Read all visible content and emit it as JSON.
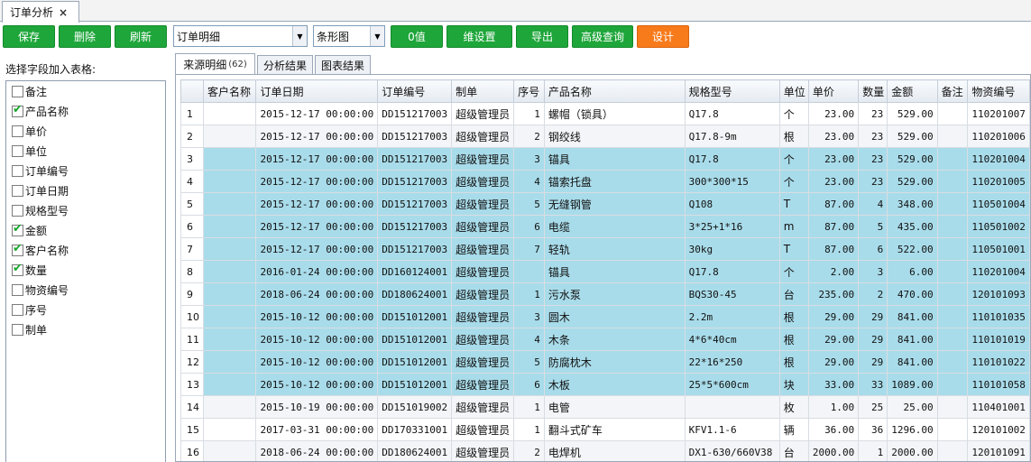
{
  "tab": {
    "title": "订单分析",
    "close": "×"
  },
  "toolbar": {
    "save": "保存",
    "delete": "删除",
    "refresh": "刷新",
    "report_select": "订单明细",
    "chart_select": "条形图",
    "zero_value": "0值",
    "dimension": "维设置",
    "export": "导出",
    "advanced_query": "高级查询",
    "design": "设计"
  },
  "fields": {
    "title": "选择字段加入表格:",
    "items": [
      {
        "label": "备注",
        "checked": false
      },
      {
        "label": "产品名称",
        "checked": true
      },
      {
        "label": "单价",
        "checked": false
      },
      {
        "label": "单位",
        "checked": false
      },
      {
        "label": "订单编号",
        "checked": false
      },
      {
        "label": "订单日期",
        "checked": false
      },
      {
        "label": "规格型号",
        "checked": false
      },
      {
        "label": "金额",
        "checked": true
      },
      {
        "label": "客户名称",
        "checked": true
      },
      {
        "label": "数量",
        "checked": true
      },
      {
        "label": "物资编号",
        "checked": false
      },
      {
        "label": "序号",
        "checked": false
      },
      {
        "label": "制单",
        "checked": false
      }
    ]
  },
  "result_tabs": {
    "source": "来源明细",
    "count": "(62)",
    "analysis": "分析结果",
    "chart": "图表结果"
  },
  "grid": {
    "columns": [
      "",
      "客户名称",
      "订单日期",
      "订单编号",
      "制单",
      "序号",
      "产品名称",
      "规格型号",
      "单位",
      "单价",
      "数量",
      "金额",
      "备注",
      "物资编号"
    ],
    "rows": [
      {
        "n": "1",
        "cust": "",
        "date": "2015-12-17 00:00:00",
        "order": "DD151217003",
        "maker": "超级管理员",
        "seq": "1",
        "product": "螺帽（锁具）",
        "spec": "Q17.8",
        "unit": "个",
        "price": "23.00",
        "qty": "23",
        "amount": "529.00",
        "note": "",
        "code": "110201007",
        "sel": false
      },
      {
        "n": "2",
        "cust": "",
        "date": "2015-12-17 00:00:00",
        "order": "DD151217003",
        "maker": "超级管理员",
        "seq": "2",
        "product": "钢绞线",
        "spec": "Q17.8-9m",
        "unit": "根",
        "price": "23.00",
        "qty": "23",
        "amount": "529.00",
        "note": "",
        "code": "110201006",
        "sel": false
      },
      {
        "n": "3",
        "cust": "",
        "date": "2015-12-17 00:00:00",
        "order": "DD151217003",
        "maker": "超级管理员",
        "seq": "3",
        "product": "锚具",
        "spec": "Q17.8",
        "unit": "个",
        "price": "23.00",
        "qty": "23",
        "amount": "529.00",
        "note": "",
        "code": "110201004",
        "sel": true
      },
      {
        "n": "4",
        "cust": "",
        "date": "2015-12-17 00:00:00",
        "order": "DD151217003",
        "maker": "超级管理员",
        "seq": "4",
        "product": "锚索托盘",
        "spec": "300*300*15",
        "unit": "个",
        "price": "23.00",
        "qty": "23",
        "amount": "529.00",
        "note": "",
        "code": "110201005",
        "sel": true
      },
      {
        "n": "5",
        "cust": "",
        "date": "2015-12-17 00:00:00",
        "order": "DD151217003",
        "maker": "超级管理员",
        "seq": "5",
        "product": "无缝钢管",
        "spec": "Q108",
        "unit": "T",
        "price": "87.00",
        "qty": "4",
        "amount": "348.00",
        "note": "",
        "code": "110501004",
        "sel": true
      },
      {
        "n": "6",
        "cust": "",
        "date": "2015-12-17 00:00:00",
        "order": "DD151217003",
        "maker": "超级管理员",
        "seq": "6",
        "product": "电缆",
        "spec": "3*25+1*16",
        "unit": "m",
        "price": "87.00",
        "qty": "5",
        "amount": "435.00",
        "note": "",
        "code": "110501002",
        "sel": true
      },
      {
        "n": "7",
        "cust": "",
        "date": "2015-12-17 00:00:00",
        "order": "DD151217003",
        "maker": "超级管理员",
        "seq": "7",
        "product": "轻轨",
        "spec": "30kg",
        "unit": "T",
        "price": "87.00",
        "qty": "6",
        "amount": "522.00",
        "note": "",
        "code": "110501001",
        "sel": true
      },
      {
        "n": "8",
        "cust": "",
        "date": "2016-01-24 00:00:00",
        "order": "DD160124001",
        "maker": "超级管理员",
        "seq": "",
        "product": "锚具",
        "spec": "Q17.8",
        "unit": "个",
        "price": "2.00",
        "qty": "3",
        "amount": "6.00",
        "note": "",
        "code": "110201004",
        "sel": true
      },
      {
        "n": "9",
        "cust": "",
        "date": "2018-06-24 00:00:00",
        "order": "DD180624001",
        "maker": "超级管理员",
        "seq": "1",
        "product": "污水泵",
        "spec": "BQS30-45",
        "unit": "台",
        "price": "235.00",
        "qty": "2",
        "amount": "470.00",
        "note": "",
        "code": "120101093",
        "sel": true
      },
      {
        "n": "10",
        "cust": "",
        "date": "2015-10-12 00:00:00",
        "order": "DD151012001",
        "maker": "超级管理员",
        "seq": "3",
        "product": "圆木",
        "spec": "2.2m",
        "unit": "根",
        "price": "29.00",
        "qty": "29",
        "amount": "841.00",
        "note": "",
        "code": "110101035",
        "sel": true
      },
      {
        "n": "11",
        "cust": "",
        "date": "2015-10-12 00:00:00",
        "order": "DD151012001",
        "maker": "超级管理员",
        "seq": "4",
        "product": "木条",
        "spec": "4*6*40cm",
        "unit": "根",
        "price": "29.00",
        "qty": "29",
        "amount": "841.00",
        "note": "",
        "code": "110101019",
        "sel": true
      },
      {
        "n": "12",
        "cust": "",
        "date": "2015-10-12 00:00:00",
        "order": "DD151012001",
        "maker": "超级管理员",
        "seq": "5",
        "product": "防腐枕木",
        "spec": "22*16*250",
        "unit": "根",
        "price": "29.00",
        "qty": "29",
        "amount": "841.00",
        "note": "",
        "code": "110101022",
        "sel": true
      },
      {
        "n": "13",
        "cust": "",
        "date": "2015-10-12 00:00:00",
        "order": "DD151012001",
        "maker": "超级管理员",
        "seq": "6",
        "product": "木板",
        "spec": "25*5*600cm",
        "unit": "块",
        "price": "33.00",
        "qty": "33",
        "amount": "1089.00",
        "note": "",
        "code": "110101058",
        "sel": true
      },
      {
        "n": "14",
        "cust": "",
        "date": "2015-10-19 00:00:00",
        "order": "DD151019002",
        "maker": "超级管理员",
        "seq": "1",
        "product": "电管",
        "spec": "",
        "unit": "枚",
        "price": "1.00",
        "qty": "25",
        "amount": "25.00",
        "note": "",
        "code": "110401001",
        "sel": false
      },
      {
        "n": "15",
        "cust": "",
        "date": "2017-03-31 00:00:00",
        "order": "DD170331001",
        "maker": "超级管理员",
        "seq": "1",
        "product": "翻斗式矿车",
        "spec": "KFV1.1-6",
        "unit": "辆",
        "price": "36.00",
        "qty": "36",
        "amount": "1296.00",
        "note": "",
        "code": "120101002",
        "sel": false
      },
      {
        "n": "16",
        "cust": "",
        "date": "2018-06-24 00:00:00",
        "order": "DD180624001",
        "maker": "超级管理员",
        "seq": "2",
        "product": "电焊机",
        "spec": "DX1-630/660V38",
        "unit": "台",
        "price": "2000.00",
        "qty": "1",
        "amount": "2000.00",
        "note": "",
        "code": "120101091",
        "sel": false
      }
    ]
  }
}
